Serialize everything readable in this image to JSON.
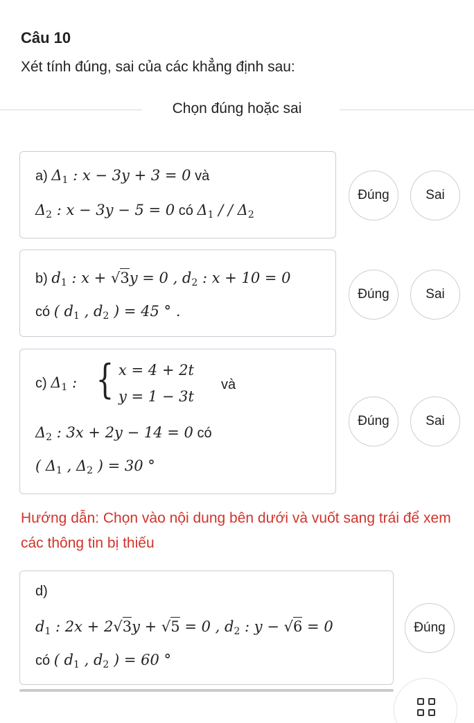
{
  "question": {
    "title": "Câu 10",
    "prompt": "Xét tính đúng, sai của các khẳng định sau:",
    "divider_label": "Chọn đúng hoặc sai"
  },
  "statements": [
    {
      "label": "a)",
      "join_and": "và",
      "join_has": "có",
      "true_label": "Đúng",
      "false_label": "Sai"
    },
    {
      "label": "b)",
      "join_has": "có",
      "true_label": "Đúng",
      "false_label": "Sai"
    },
    {
      "label": "c)",
      "join_and": "và",
      "join_has": "có",
      "true_label": "Đúng",
      "false_label": "Sai"
    },
    {
      "label": "d)",
      "join_has": "có",
      "true_label": "Đúng"
    }
  ],
  "hint": "Hướng dẫn: Chọn vào nội dung bên dưới và vuốt sang trái để xem các thông tin bị thiếu",
  "icons": {
    "grid_button": "grid-icon"
  },
  "colors": {
    "hint": "#d0342c",
    "border": "#c9ced4",
    "background": "#ffffff"
  }
}
